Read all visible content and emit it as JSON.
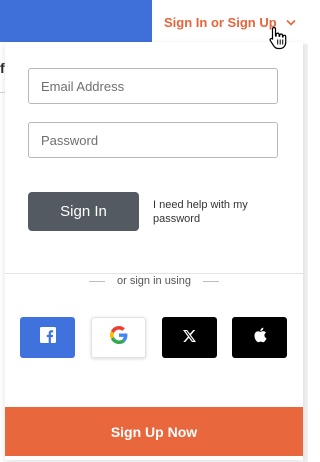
{
  "header": {
    "trigger_label": "Sign In or Sign Up"
  },
  "background": {
    "left_text_fragment": "f"
  },
  "form": {
    "email_placeholder": "Email Address",
    "password_placeholder": "Password",
    "signin_label": "Sign In",
    "help_text": "I need help with my password"
  },
  "social": {
    "divider_text": "or sign in using",
    "providers": [
      {
        "name": "Facebook",
        "icon": "facebook-icon"
      },
      {
        "name": "Google",
        "icon": "google-icon"
      },
      {
        "name": "X",
        "icon": "x-icon"
      },
      {
        "name": "Apple",
        "icon": "apple-icon"
      }
    ]
  },
  "footer": {
    "signup_label": "Sign Up Now"
  },
  "colors": {
    "accent": "#e8673d",
    "header_blue": "#3f6fd8",
    "signin_button": "#535a62",
    "facebook": "#3f72dc"
  }
}
